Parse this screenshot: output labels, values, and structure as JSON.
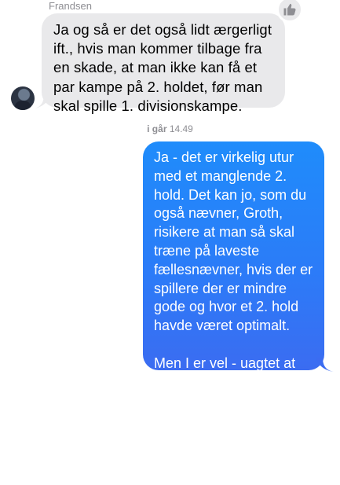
{
  "incoming": {
    "sender_name": "Frandsen",
    "text": "Ja og så er det også lidt ærgerligt ift., hvis man kommer tilbage fra en skade, at man ikke kan få et par kampe på 2. holdet, før man skal spille 1. divisionskampe.",
    "reaction_icon": "thumbs-up-icon"
  },
  "timestamp": {
    "day": "i går",
    "time": "14.49"
  },
  "outgoing": {
    "text": "Ja - det er virkelig utur med et manglende 2. hold. Det kan jo, som du også nævner, Groth, risikere at man så skal træne på laveste fællesnævner, hvis der er spillere der er mindre gode og hvor et 2. hold havde været optimalt.\n\nMen I er vel - uagtet at ligningen går op - udfordret af, at der er spillere der spiller de samme positioner, som så skal frasorteres. Hvad siger du, Sille?"
  },
  "colors": {
    "incoming_bubble": "#e9e9eb",
    "outgoing_bubble": "#2b7cf8",
    "meta_text": "#8e8e93"
  }
}
